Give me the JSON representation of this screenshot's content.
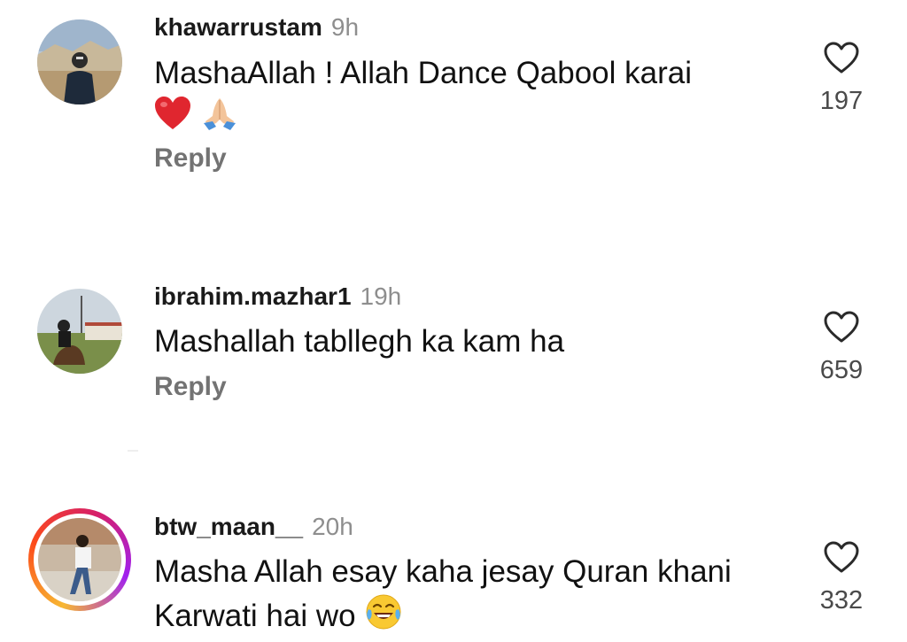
{
  "comments": [
    {
      "username": "khawarrustam",
      "time": "9h",
      "text": "MashaAllah ! Allah Dance Qabool karai",
      "emojis": [
        "red-heart",
        "folded-hands"
      ],
      "reply_label": "Reply",
      "likes": "197"
    },
    {
      "username": "ibrahim.mazhar1",
      "time": "19h",
      "text": "Mashallah tabllegh ka kam ha",
      "reply_label": "Reply",
      "likes": "659"
    },
    {
      "username": "btw_maan__",
      "time": "20h",
      "text_line1": "Masha Allah esay kaha jesay Quran khani",
      "text_line2": "Karwati hai wo",
      "emojis": [
        "face-with-tears-of-joy"
      ],
      "likes": "332",
      "has_story_ring": true
    }
  ],
  "icons": {
    "like": "heart-outline-icon"
  }
}
